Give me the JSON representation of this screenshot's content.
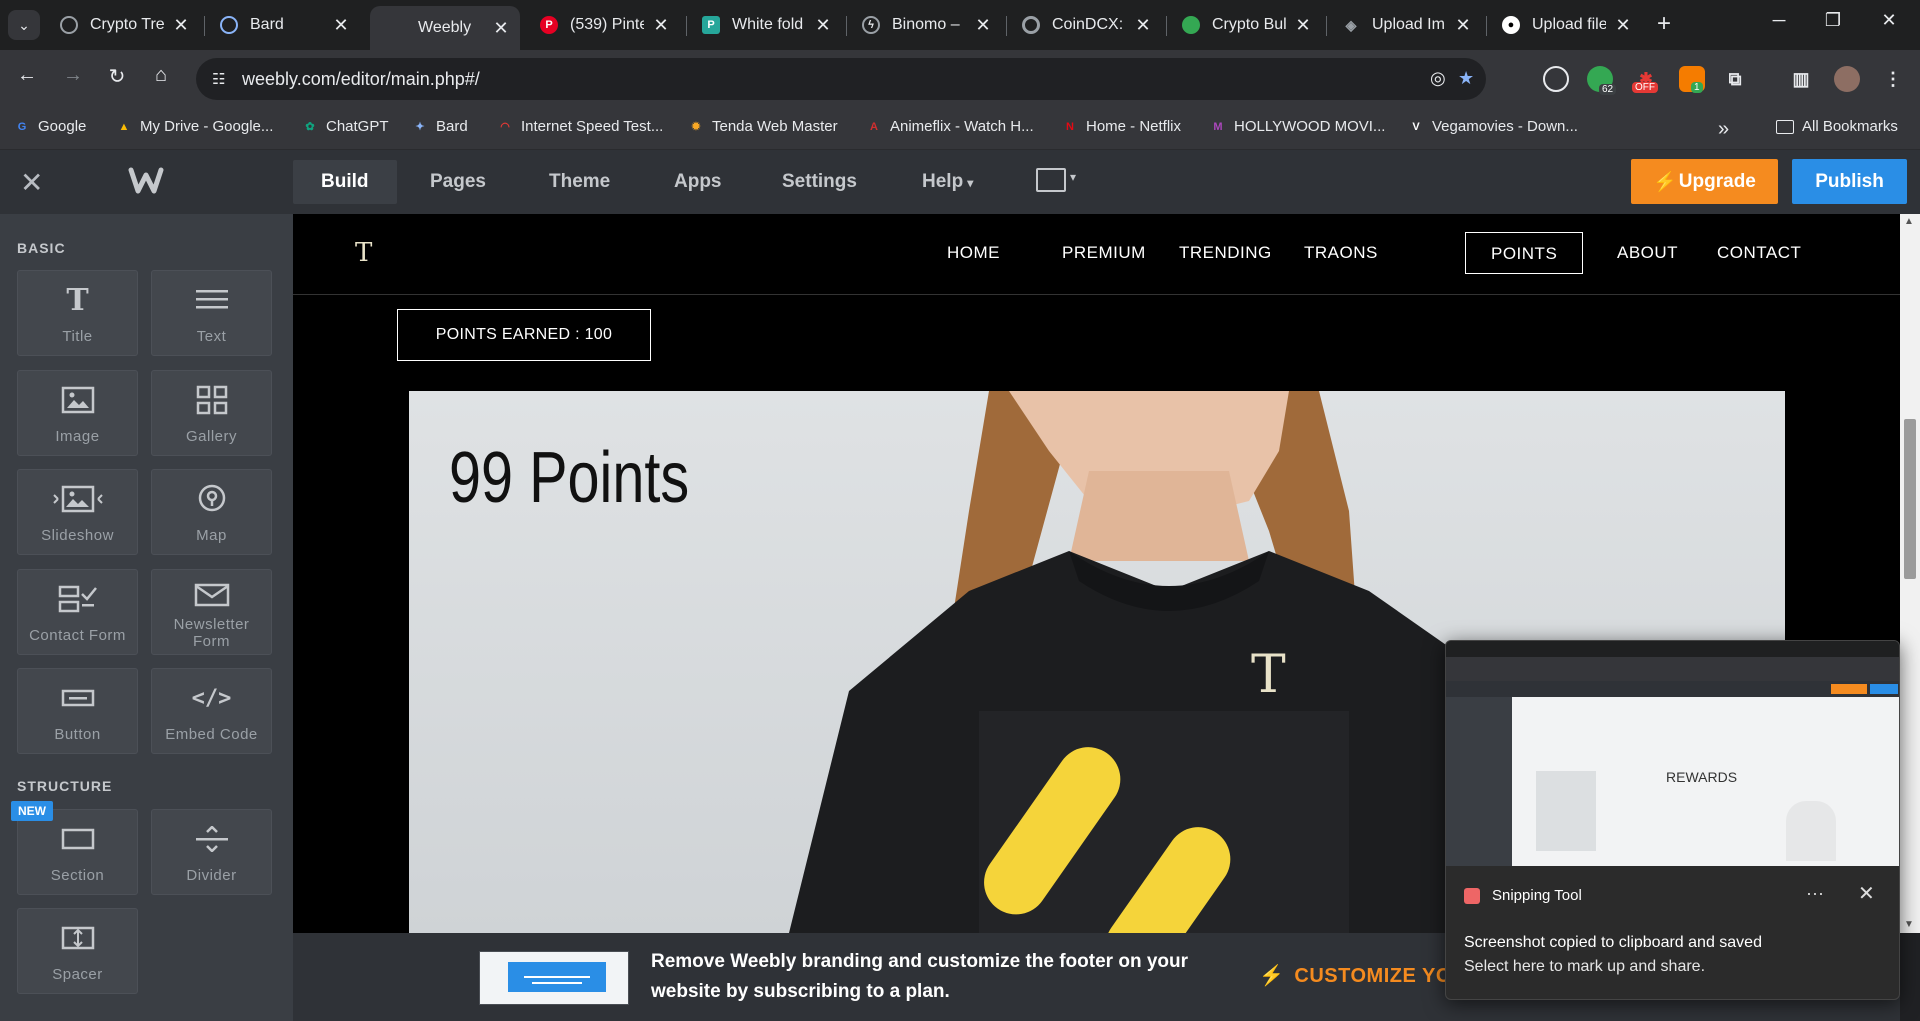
{
  "browser": {
    "tabs": [
      {
        "title": "Crypto Tre",
        "icon": "generic-site-icon",
        "color": "#9aa0a6"
      },
      {
        "title": "Bard",
        "icon": "bard-icon",
        "color": "#8ab4f8"
      },
      {
        "title": "Weebly",
        "icon": "",
        "color": "",
        "active": true
      },
      {
        "title": "(539) Pinte",
        "icon": "pinterest-icon",
        "color": "#e60023"
      },
      {
        "title": "White fold",
        "icon": "document-icon",
        "color": "#26a69a"
      },
      {
        "title": "Binomo – ",
        "icon": "lightning-icon",
        "color": "#5f6368"
      },
      {
        "title": "CoinDCX: ",
        "icon": "coindcx-icon",
        "color": "#9aa0a6"
      },
      {
        "title": "Crypto Bul",
        "icon": "globe-icon",
        "color": "#34a853"
      },
      {
        "title": "Upload Im",
        "icon": "layers-icon",
        "color": "#9aa0a6"
      },
      {
        "title": "Upload file",
        "icon": "github-icon",
        "color": "#ffffff"
      }
    ],
    "url": "weebly.com/editor/main.php#/",
    "extension_badge": "62",
    "extension_off": "OFF",
    "extension_count": "1",
    "bookmarks": [
      {
        "label": "Google",
        "icon": "google-icon",
        "color": "#4285f4"
      },
      {
        "label": "My Drive - Google...",
        "icon": "drive-icon",
        "color": "#fbbc04"
      },
      {
        "label": "ChatGPT",
        "icon": "chatgpt-icon",
        "color": "#10a37f"
      },
      {
        "label": "Bard",
        "icon": "bard-icon",
        "color": "#8ab4f8"
      },
      {
        "label": "Internet Speed Test...",
        "icon": "speedometer-icon",
        "color": "#e53935"
      },
      {
        "label": "Tenda Web Master",
        "icon": "tenda-icon",
        "color": "#f9a825"
      },
      {
        "label": "Animeflix - Watch H...",
        "icon": "animeflix-icon",
        "color": "#d32f2f"
      },
      {
        "label": "Home - Netflix",
        "icon": "netflix-icon",
        "color": "#e50914"
      },
      {
        "label": "HOLLYWOOD MOVI...",
        "icon": "hollywood-icon",
        "color": "#ab47bc"
      },
      {
        "label": "Vegamovies - Down...",
        "icon": "vegamovies-icon",
        "color": "#ffffff"
      }
    ],
    "all_bookmarks": "All Bookmarks"
  },
  "editor": {
    "nav": [
      "Build",
      "Pages",
      "Theme",
      "Apps",
      "Settings",
      "Help"
    ],
    "upgrade": "Upgrade",
    "publish": "Publish"
  },
  "sidebar": {
    "basic_heading": "BASIC",
    "structure_heading": "STRUCTURE",
    "new_badge": "NEW",
    "elements": [
      {
        "label": "Title",
        "icon": "title-icon"
      },
      {
        "label": "Text",
        "icon": "text-icon"
      },
      {
        "label": "Image",
        "icon": "image-icon"
      },
      {
        "label": "Gallery",
        "icon": "gallery-icon"
      },
      {
        "label": "Slideshow",
        "icon": "slideshow-icon"
      },
      {
        "label": "Map",
        "icon": "map-pin-icon"
      },
      {
        "label": "Contact Form",
        "icon": "contact-form-icon"
      },
      {
        "label": "Newsletter Form",
        "icon": "envelope-icon"
      },
      {
        "label": "Button",
        "icon": "button-icon"
      },
      {
        "label": "Embed Code",
        "icon": "code-icon"
      }
    ],
    "structure": [
      {
        "label": "Section",
        "icon": "section-icon"
      },
      {
        "label": "Divider",
        "icon": "divider-icon"
      },
      {
        "label": "Spacer",
        "icon": "spacer-icon"
      }
    ]
  },
  "site": {
    "logo": "T",
    "nav": [
      "HOME",
      "PREMIUM",
      "TRENDING",
      "TRAONS",
      "POINTS",
      "ABOUT",
      "CONTACT"
    ],
    "active_nav": "POINTS",
    "points_earned": "POINTS EARNED :  100",
    "hero_title": "99 Points",
    "shirt_logo": "T"
  },
  "footer": {
    "text": "Remove Weebly branding and customize the footer on your website by subscribing to a plan.",
    "cta": "CUSTOMIZE YO"
  },
  "toast": {
    "app": "Snipping Tool",
    "line1": "Screenshot copied to clipboard and saved",
    "line2": "Select here to mark up and share.",
    "thumb_label": "REWARDS"
  },
  "colors": {
    "upgrade": "#f58b1f",
    "publish": "#2a8ee6",
    "shirt_accent": "#f5d43a"
  }
}
